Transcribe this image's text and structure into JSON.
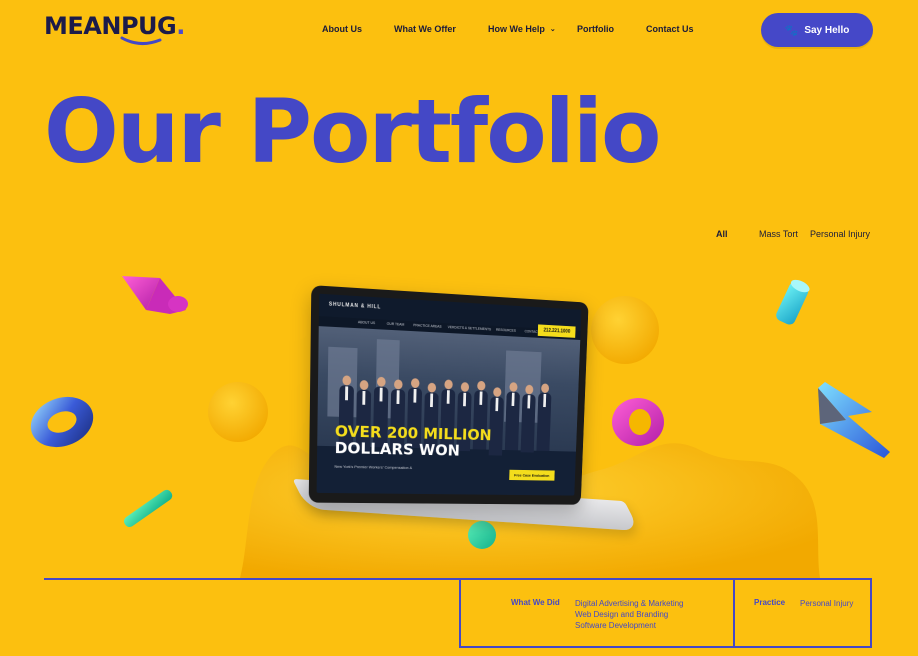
{
  "header": {
    "logo_text": "MEANPUG",
    "logo_dot": ".",
    "nav": [
      {
        "label": "About Us"
      },
      {
        "label": "What We Offer"
      },
      {
        "label": "How We Help",
        "has_dropdown": true
      },
      {
        "label": "Portfolio"
      },
      {
        "label": "Contact Us"
      }
    ],
    "cta_label": "Say Hello",
    "cta_icon": "paw-icon"
  },
  "page_title": "Our Portfolio",
  "filters": [
    {
      "label": "All",
      "active": true
    },
    {
      "label": "Mass Tort",
      "active": false
    },
    {
      "label": "Personal Injury",
      "active": false
    }
  ],
  "mockup": {
    "site_logo": "SHULMAN & HILL",
    "site_phone": "212.221.1000",
    "site_nav": [
      "ABOUT US",
      "OUR TEAM",
      "PRACTICE AREAS",
      "VERDICTS & SETTLEMENTS",
      "RESOURCES",
      "CONTACT US"
    ],
    "headline_line1": "OVER 200 MILLION",
    "headline_line2": "DOLLARS WON",
    "subtext": "New York's Premier Workers' Compensation &",
    "cta": "Free Case Evaluation"
  },
  "project_info": {
    "what_we_did_label": "What We Did",
    "what_we_did": [
      "Digital Advertising & Marketing",
      "Web Design and Branding",
      "Software Development"
    ],
    "practice_label": "Practice",
    "practice_value": "Personal Injury"
  },
  "colors": {
    "background": "#fcc00f",
    "accent": "#4448c6",
    "navy": "#1b1b3a"
  }
}
